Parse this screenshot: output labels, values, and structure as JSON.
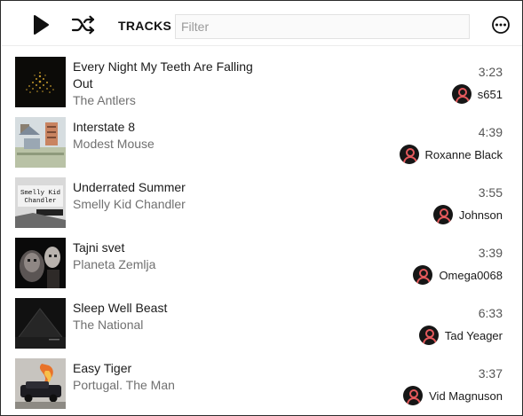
{
  "toolbar": {
    "play_icon": "play-icon",
    "shuffle_icon": "shuffle-icon",
    "title": "TRACKS",
    "filter_placeholder": "Filter",
    "filter_value": "",
    "more_icon": "more-options-icon"
  },
  "tracks": [
    {
      "title": "Every Night My Teeth Are Falling Out",
      "artist": "The Antlers",
      "duration": "3:23",
      "user": "s651",
      "art": "antlers"
    },
    {
      "title": "Interstate 8",
      "artist": "Modest Mouse",
      "duration": "4:39",
      "user": "Roxanne Black",
      "art": "modest-mouse"
    },
    {
      "title": "Underrated Summer",
      "artist": "Smelly Kid Chandler",
      "duration": "3:55",
      "user": "Johnson",
      "art": "smelly-kid",
      "art_text": [
        "Smelly Kid",
        "Chandler"
      ]
    },
    {
      "title": "Tajni svet",
      "artist": "Planeta Zemlja",
      "duration": "3:39",
      "user": "Omega0068",
      "art": "planeta"
    },
    {
      "title": "Sleep Well Beast",
      "artist": "The National",
      "duration": "6:33",
      "user": "Tad Yeager",
      "art": "national"
    },
    {
      "title": "Easy Tiger",
      "artist": "Portugal. The Man",
      "duration": "3:37",
      "user": "Vid Magnuson",
      "art": "portugal"
    }
  ],
  "colors": {
    "avatar_bg": "#161616",
    "avatar_fg": "#e4595c"
  }
}
